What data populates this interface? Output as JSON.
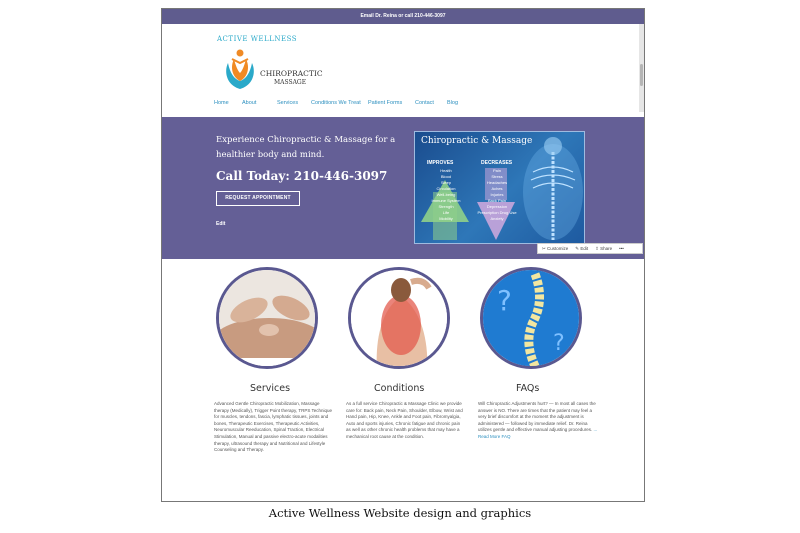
{
  "topbar": {
    "text": "Email Dr. Reina or call 210-446-3097"
  },
  "logo": {
    "brand_top": "ACTIVE WELLNESS",
    "brand_a": "CHIROPRACTIC",
    "brand_b": "MASSAGE"
  },
  "nav": [
    "Home",
    "About",
    "Services",
    "Conditions We Treat",
    "Patient Forms",
    "Contact",
    "Blog"
  ],
  "hero": {
    "tagline": "Experience Chiropractic & Massage for a healthier body and mind.",
    "call": "Call Today: 210-446-3097",
    "request_button": "REQUEST APPOINTMENT",
    "edit_link": "Edit"
  },
  "panel": {
    "title": "Chiropractic & Massage",
    "improves_head": "IMPROVES",
    "improves": [
      "Health",
      "Blood",
      "Sleep",
      "Circulation",
      "Well-being",
      "Immune System",
      "Strength",
      "Life",
      "Mobility"
    ],
    "decreases_head": "DECREASES",
    "decreases": [
      "Pain",
      "Stress",
      "Headaches",
      "Aches",
      "Injuries",
      "Back Pain",
      "Depression",
      "Prescription Drug Use",
      "Anxiety"
    ]
  },
  "toolbar": {
    "customize": "Customize",
    "edit": "Edit",
    "share": "Share",
    "more": "•••"
  },
  "features": [
    {
      "title": "Services",
      "body": "Advanced Gentle Chiropractic Mobilization, Massage therapy (Medically), Trigger Point therapy, TRPS Technique for muscles, tendons, fascia, lymphatic tissues, joints and bones, Therapeutic Exercises, Therapeutic Activities, Neuromuscular Reeducation, Spinal Traction, Electrical Stimulation, Manual and passive electro-acute modalities therapy, ultrasound therapy and Nutritional and Lifestyle Counseling and Therapy.",
      "more": ""
    },
    {
      "title": "Conditions",
      "body": "As a full service Chiropractic & Massage Clinic we provide care for: Back pain, Neck Pain, Shoulder, Elbow, Wrist and Hand pain, Hip, Knee, Ankle and Foot pain, Fibromyalgia, Auto and sports injuries, Chronic fatigue and chronic pain as well as other chronic health problems that may have a mechanical root cause at the condition.",
      "more": ""
    },
    {
      "title": "FAQs",
      "body": "Will Chiropractic Adjustments hurt? — In most all cases the answer is NO. There are times that the patient may feel a very brief discomfort at the moment the adjustment is administered — followed by immediate relief. Dr. Reina utilizes gentle and effective manual adjusting procedures.",
      "more": "... Read More FAQ"
    }
  ],
  "caption": "Active Wellness Website design and graphics",
  "colors": {
    "topbar": "#5f5c8e",
    "hero": "#645f96",
    "link": "#2b8fbf",
    "logo": "#2aa9c9"
  }
}
